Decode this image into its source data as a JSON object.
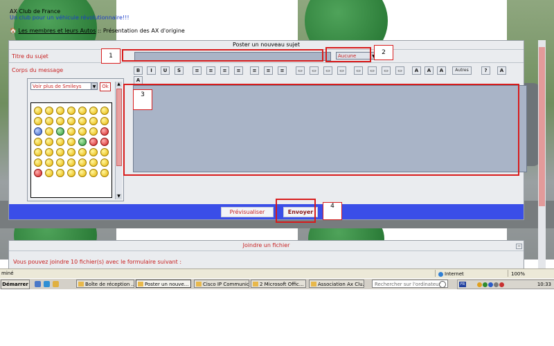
{
  "site": {
    "title": "AX Club de France",
    "tagline": "Un club pour un véhicule révolutionnaire!!!",
    "breadcrumb_link": "Les membres et leurs Autos",
    "breadcrumb_sep": " :: ",
    "breadcrumb_current": "Présentation des AX d'origine"
  },
  "form": {
    "panel_title": "Poster un nouveau sujet",
    "subject_label": "Titre du sujet",
    "subject_value": "",
    "icon_select_value": "Aucune",
    "body_label": "Corps du message",
    "smiley_select": "Voir plus de Smileys",
    "ok_label": "Ok",
    "editor_value": "",
    "toolbar": [
      "B",
      "I",
      "U",
      "S",
      "≡",
      "≡",
      "≡",
      "≡",
      "≡",
      "≡",
      "≡",
      "▭",
      "▭",
      "▭",
      "▭",
      "▭",
      "▭",
      "▭",
      "▭",
      "A",
      "A",
      "A",
      "Autres",
      "?",
      "A",
      "A"
    ],
    "preview_label": "Prévisualiser",
    "send_label": "Envoyer"
  },
  "annotations": [
    "1",
    "2",
    "3",
    "4"
  ],
  "attachment": {
    "title": "Joindre un fichier",
    "text": "Vous pouvez joindre 10 fichier(s) avec le formulaire suivant :"
  },
  "statusbar": {
    "left": "miné",
    "zone": "Internet",
    "zoom": "100%"
  },
  "taskbar": {
    "start": "Démarrer",
    "tasks": [
      "Boîte de réception ...",
      "Poster un nouve...",
      "Cisco IP Communic...",
      "2 Microsoft Offic...",
      "Association Ax Clu..."
    ],
    "search_placeholder": "Rechercher sur l'ordinateur",
    "lang": "FR",
    "clock": "10:33"
  }
}
